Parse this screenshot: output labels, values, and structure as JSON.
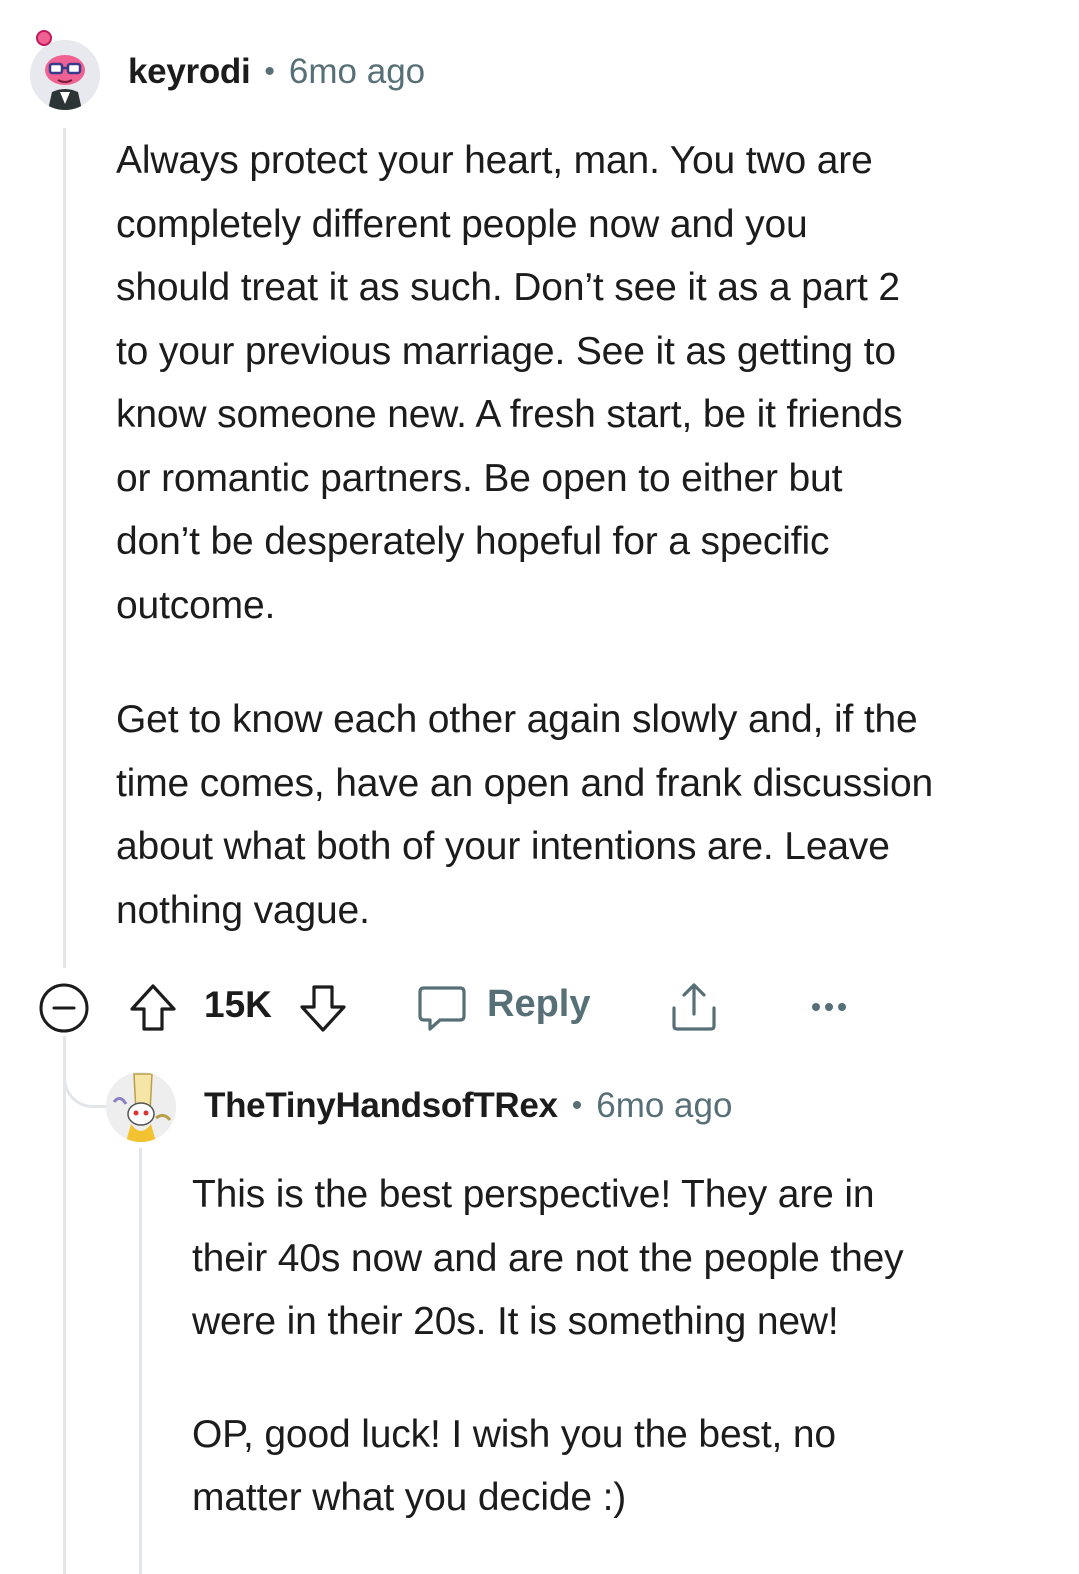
{
  "comment": {
    "username": "keyrodi",
    "separator": "•",
    "time": "6mo ago",
    "paragraph1": [
      "Always protect your heart, man. You two are",
      "completely different people now and you",
      "should treat it as such. Don’t see it as a part 2",
      "to your previous marriage. See it as getting to",
      "know someone new. A fresh start, be it friends",
      "or romantic partners. Be open to either but",
      "don’t be desperately hopeful for a specific",
      "outcome."
    ],
    "paragraph2": [
      "Get to know each other again slowly and, if the",
      "time comes, have an open and frank discussion",
      "about what both of your intentions are. Leave",
      "nothing vague."
    ]
  },
  "actions": {
    "upvote_count": "15K",
    "reply_label": "Reply",
    "icons": [
      "collapse-icon",
      "upvote-icon",
      "downvote-icon",
      "comment-bubble-icon",
      "share-icon",
      "more-options-icon"
    ]
  },
  "reply": {
    "username": "TheTinyHandsofTRex",
    "separator": "•",
    "time": "6mo ago",
    "paragraph1": [
      "This is the best perspective! They are in",
      "their 40s now and are not the people they",
      "were in their 20s. It is something new!"
    ],
    "paragraph2": [
      "OP, good luck! I wish you the best, no",
      "matter what you decide :)"
    ]
  },
  "colors": {
    "text": "#1c1c1c",
    "muted": "#576f76",
    "thread_line": "#e3e6e8",
    "avatar1_bg": "#e7e9ee",
    "avatar1_accent": "#e8508a"
  }
}
